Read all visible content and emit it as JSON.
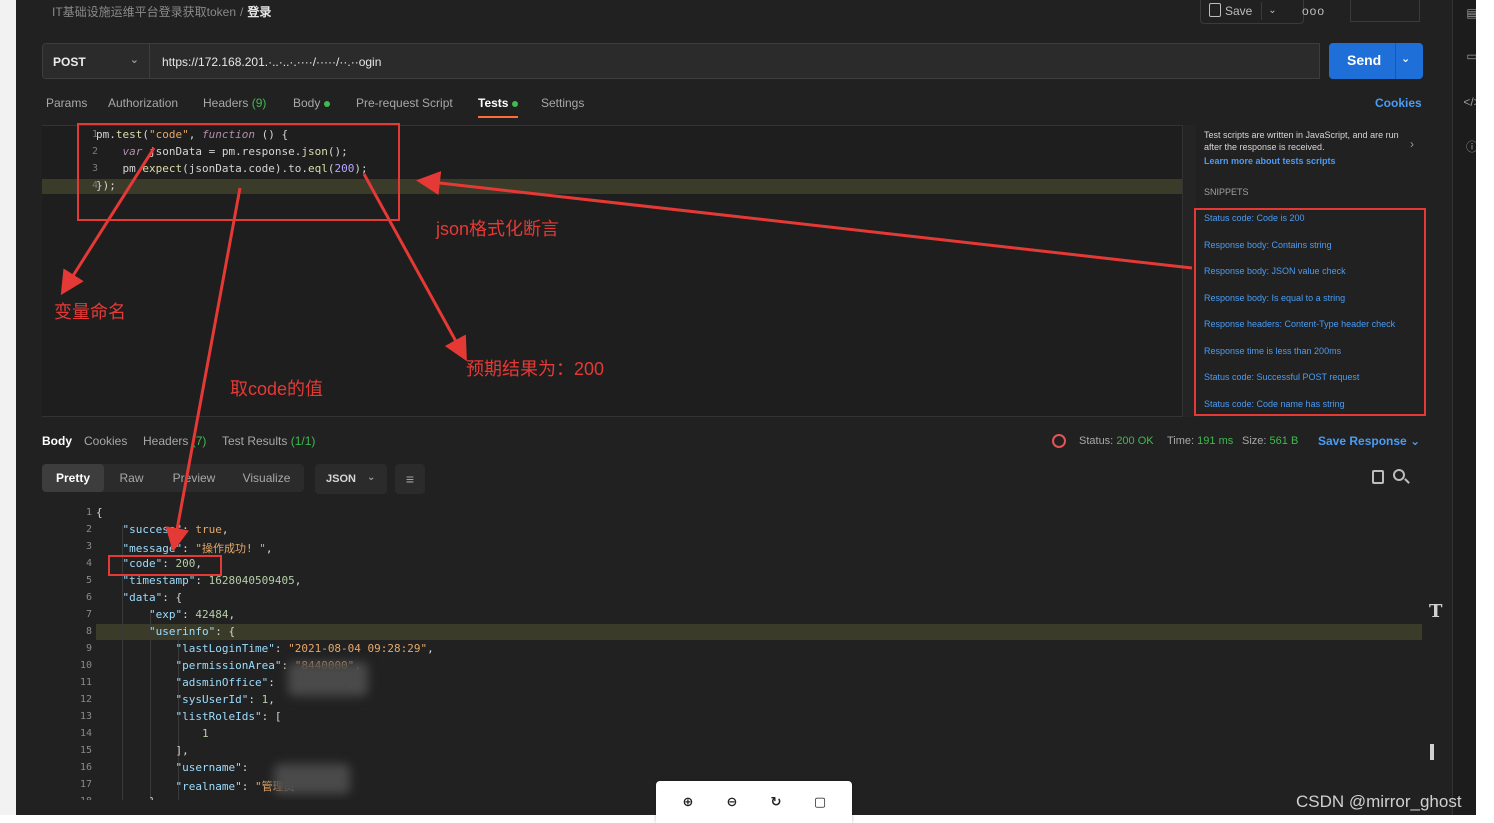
{
  "breadcrumb": {
    "collection": "IT基础设施运维平台登录获取token",
    "separator": "/",
    "current": "登录"
  },
  "toolbar": {
    "save_label": "Save",
    "more_label": "ooo"
  },
  "request": {
    "method": "POST",
    "url": "https://172.168.201.·..·..·.····/·····/··.··ogin",
    "send_label": "Send"
  },
  "request_tabs": [
    {
      "label": "Params"
    },
    {
      "label": "Authorization"
    },
    {
      "label": "Headers",
      "count": "(9)"
    },
    {
      "label": "Body"
    },
    {
      "label": "Pre-request Script"
    },
    {
      "label": "Tests"
    },
    {
      "label": "Settings"
    }
  ],
  "cookies_label": "Cookies",
  "tests_editor": {
    "lines": [
      "1",
      "2",
      "3",
      "4"
    ]
  },
  "snippets_panel": {
    "description": "Test scripts are written in JavaScript, and are run after the response is received.",
    "learn_more": "Learn more about tests scripts",
    "title": "SNIPPETS",
    "items": [
      "Status code: Code is 200",
      "Response body: Contains string",
      "Response body: JSON value check",
      "Response body: Is equal to a string",
      "Response headers: Content-Type header check",
      "Response time is less than 200ms",
      "Status code: Successful POST request",
      "Status code: Code name has string"
    ]
  },
  "response_tabs": [
    {
      "label": "Body"
    },
    {
      "label": "Cookies"
    },
    {
      "label": "Headers",
      "count": "(7)"
    },
    {
      "label": "Test Results",
      "count": "(1/1)"
    }
  ],
  "response_meta": {
    "status_label": "Status:",
    "status_value": "200 OK",
    "time_label": "Time:",
    "time_value": "191 ms",
    "size_label": "Size:",
    "size_value": "561 B",
    "save_response": "Save Response"
  },
  "format_bar": {
    "buttons": [
      "Pretty",
      "Raw",
      "Preview",
      "Visualize"
    ],
    "format": "JSON"
  },
  "response_body": {
    "line_numbers": [
      "1",
      "2",
      "3",
      "4",
      "5",
      "6",
      "7",
      "8",
      "9",
      "10",
      "11",
      "12",
      "13",
      "14",
      "15",
      "16",
      "17",
      "18"
    ],
    "timestamp": "1628040509405",
    "message": "\"操作成功! \"",
    "last_login": "\"2021-08-04 09:28:29\"",
    "permission_area": "\"8440000\"",
    "exp": "42484"
  },
  "annotations": {
    "var_naming": "变量命名",
    "json_assert": "json格式化断言",
    "expected": "预期结果为：200",
    "get_code": "取code的值"
  },
  "watermark": "CSDN @mirror_ghost",
  "colors": {
    "accent": "#1f6fd9",
    "annotation": "#e53935",
    "status_ok": "#3fb950",
    "tab_underline": "#ff6c37"
  }
}
